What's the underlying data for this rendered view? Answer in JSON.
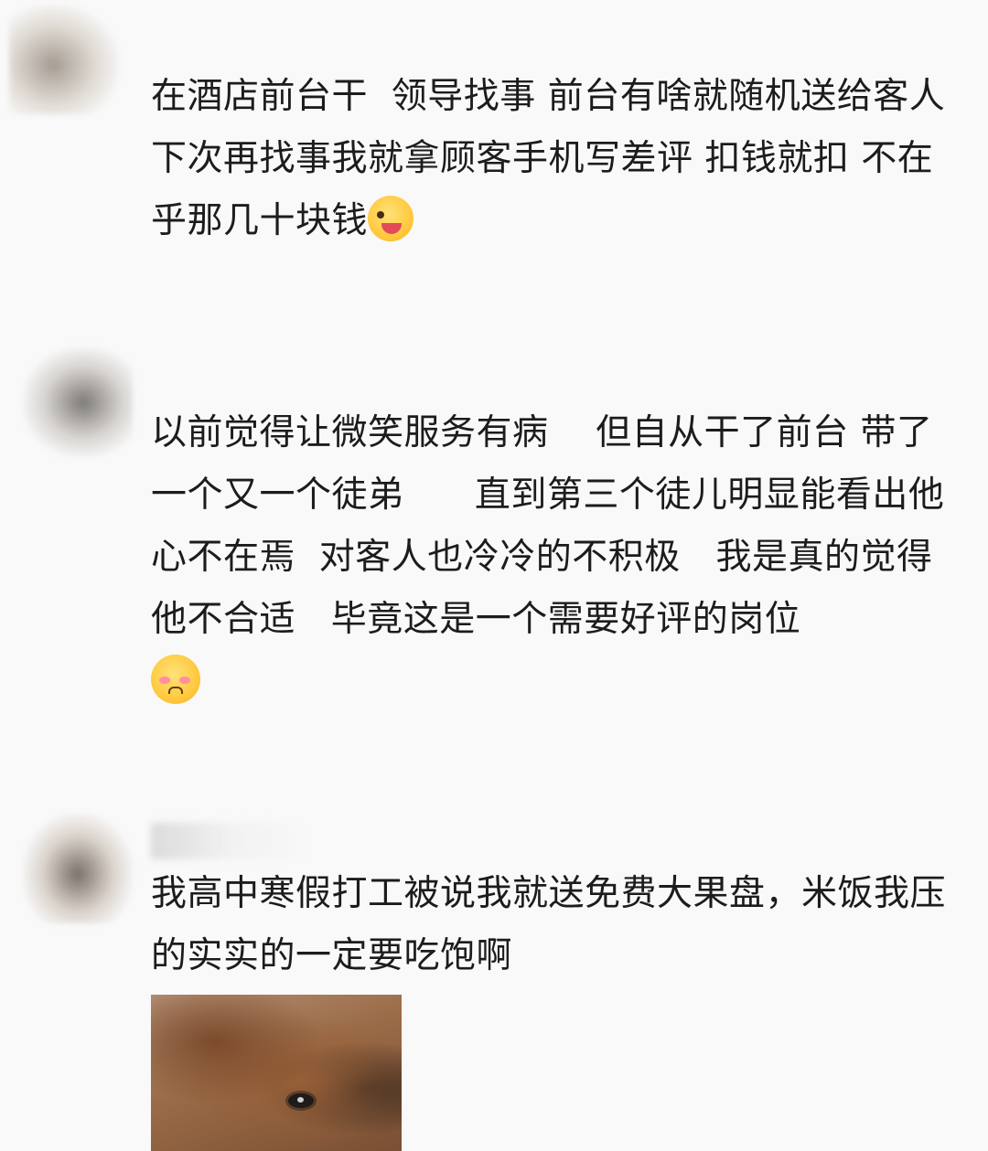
{
  "comments": [
    {
      "text": "在酒店前台干  领导找事 前台有啥就随机送给客人   下次再找事我就拿顾客手机写差评 扣钱就扣 不在乎那几十块钱",
      "emoji": "wink-tongue-emoji"
    },
    {
      "text": "以前觉得让微笑服务有病    但自从干了前台 带了一个又一个徒弟      直到第三个徒儿明显能看出他心不在焉  对客人也冷冷的不积极   我是真的觉得他不合适   毕竟这是一个需要好评的岗位",
      "emoji": "pleading-blush-emoji"
    },
    {
      "text": "我高中寒假打工被说我就送免费大果盘，米饭我压的实实的一定要吃饱啊",
      "image": "dog-photo"
    }
  ]
}
